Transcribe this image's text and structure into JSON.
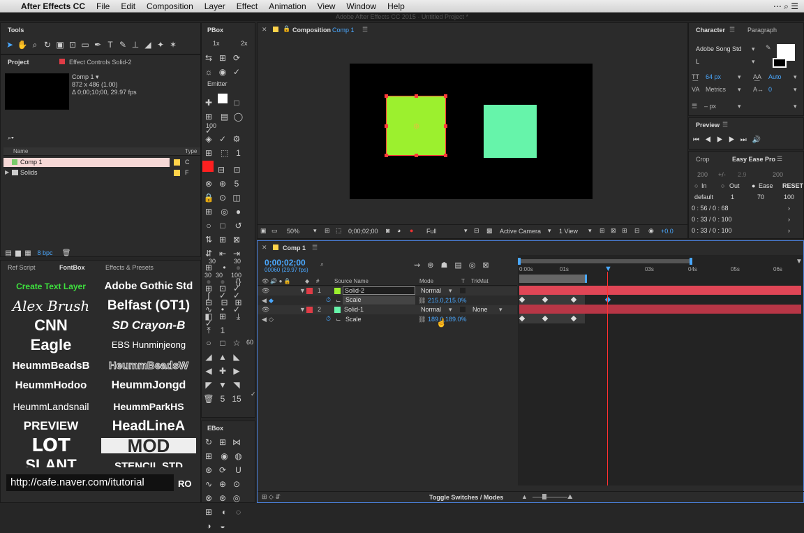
{
  "menubar": {
    "apple": "",
    "app": "After Effects CC",
    "items": [
      "File",
      "Edit",
      "Composition",
      "Layer",
      "Effect",
      "Animation",
      "View",
      "Window",
      "Help"
    ]
  },
  "window_title": "Adobe After Effects CC 2015 · Untitled Project *",
  "tools": {
    "title": "Tools"
  },
  "project": {
    "tab": "Project",
    "effect_tab": "Effect Controls Solid-2",
    "comp_name": "Comp 1 ▾",
    "comp_dims": "872 x 486 (1.00)",
    "comp_dur": "Δ 0;00;10;00, 29.97 fps",
    "search_icon": "⌕▾",
    "col_name": "Name",
    "col_type": "Type",
    "items": [
      {
        "name": "Comp 1",
        "color": "#ffd24a",
        "type": "C"
      },
      {
        "name": "Solids",
        "color": "#ffd24a",
        "type": "F"
      }
    ],
    "bpc": "8 bpc"
  },
  "pbox": {
    "title": "PBox",
    "zoom1": "1x",
    "zoom2": "2x",
    "emitter": "Emitter",
    "n100": "100",
    "n1": "1",
    "n5": "5",
    "ebox": "EBox",
    "n30a": "30",
    "n30b": "30",
    "n30c": "30",
    "n30d": "30",
    "n100b": "100",
    "n1b": "1",
    "n60": "60",
    "n5b": "5",
    "n15": "15"
  },
  "fontbox": {
    "tabs": [
      "Ref Script",
      "FontBox",
      "Effects & Presets"
    ],
    "fonts": [
      "Create Text Layer",
      "Adobe Gothic Std",
      "Alex Brush",
      "Belfast (OT1)",
      "CNN",
      "SD Crayon-B",
      "Eagle",
      "EBS Hunminjeong",
      "HeummBeadsB",
      "HeummBeadsW",
      "HeummHodoo",
      "HeummJongd",
      "HeummLandsnail",
      "HeummParkHS",
      "PREVIEW",
      "HeadLineA",
      "LOT",
      "MOD",
      "SLANT",
      "STENCIL STD"
    ],
    "url": "http://cafe.naver.com/itutorial",
    "ro": "RO"
  },
  "composition": {
    "tab_prefix": "Composition",
    "tab_name": "Comp 1",
    "zoom": "50%",
    "time": "0;00;02;00",
    "res": "Full",
    "camera": "Active Camera",
    "view": "1 View",
    "exposure": "+0.0",
    "solid2_color": "#9cf02e",
    "solid1_color": "#66f4aa"
  },
  "timeline": {
    "tab": "Comp 1",
    "timecode": "0;00;02;00",
    "frames": "00060 (29.97 fps)",
    "col_source": "Source Name",
    "col_mode": "Mode",
    "col_t": "T",
    "col_trkmat": "TrkMat",
    "layers": [
      {
        "num": "1",
        "name": "Solid-2",
        "mode": "Normal",
        "trkmat": "",
        "color": "#e03c46",
        "prop": "Scale",
        "value": "215.0,215.0%"
      },
      {
        "num": "2",
        "name": "Solid-1",
        "mode": "Normal",
        "trkmat": "None",
        "color": "#e03c46",
        "prop": "Scale",
        "value": "189.0,189.0%"
      }
    ],
    "ruler": [
      "0:00s",
      "01s",
      "03s",
      "04s",
      "05s",
      "06s"
    ],
    "toggle": "Toggle Switches / Modes"
  },
  "character": {
    "tabs": [
      "Character",
      "Paragraph"
    ],
    "font": "Adobe Song Std",
    "style": "L",
    "size": "64 px",
    "leading": "Auto",
    "tracking_label": "Metrics",
    "tracking": "0",
    "stroke": "– px"
  },
  "preview": {
    "title": "Preview"
  },
  "ease": {
    "tabs": [
      "Crop",
      "Easy Ease Pro"
    ],
    "v200a": "200",
    "pm": "+/-",
    "v29": "2.9",
    "v200b": "200",
    "in": "In",
    "out": "Out",
    "ease": "Ease",
    "reset": "RESET",
    "default": "default",
    "d1": "1",
    "d70": "70",
    "d100": "100",
    "r1": "0 : 56 / 0 : 68",
    "r2": "0 : 33 / 0 : 100",
    "r3": "0 : 33 / 0 : 100"
  }
}
